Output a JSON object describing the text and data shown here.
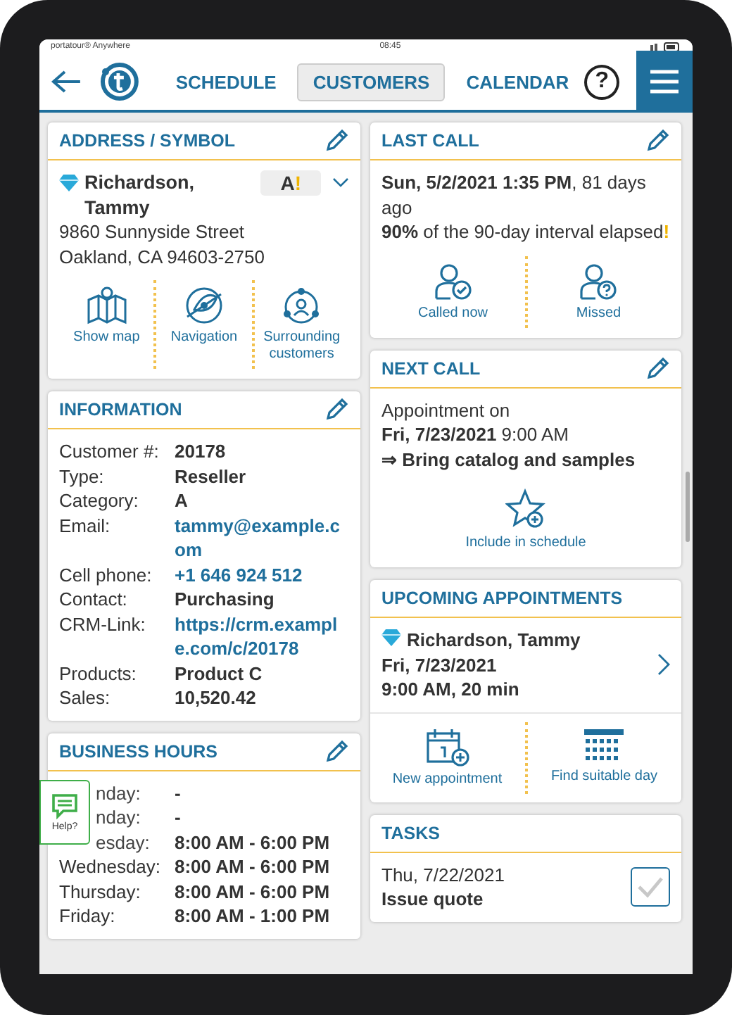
{
  "status_bar": {
    "carrier": "portatour® Anywhere",
    "time": "08:45"
  },
  "nav": {
    "tabs": [
      {
        "label": "SCHEDULE",
        "selected": false
      },
      {
        "label": "CUSTOMERS",
        "selected": true
      },
      {
        "label": "CALENDAR",
        "selected": false
      }
    ],
    "help": "?"
  },
  "address": {
    "title": "ADDRESS / SYMBOL",
    "name": "Richardson, Tammy",
    "street": "9860 Sunnyside Street",
    "city": "Oakland, CA 94603-2750",
    "symbol": "A",
    "symbol_mark": "!",
    "actions": [
      {
        "label": "Show map",
        "kind": "map"
      },
      {
        "label": "Navigation",
        "kind": "navigation"
      },
      {
        "label": "Surrounding customers",
        "kind": "surrounding"
      }
    ]
  },
  "information": {
    "title": "INFORMATION",
    "rows": [
      {
        "label": "Customer #:",
        "value": "20178",
        "kind": "text"
      },
      {
        "label": "Type:",
        "value": "Reseller",
        "kind": "text"
      },
      {
        "label": "Category:",
        "value": "A",
        "kind": "text"
      },
      {
        "label": "Email:",
        "value": "tammy@example.com",
        "kind": "link"
      },
      {
        "label": "Cell phone:",
        "value": "+1 646 924 512",
        "kind": "link"
      },
      {
        "label": "Contact:",
        "value": "Purchasing",
        "kind": "text"
      },
      {
        "label": "CRM-Link:",
        "value": "https://crm.example.com/c/20178",
        "kind": "link"
      },
      {
        "label": "Products:",
        "value": "Product C",
        "kind": "text"
      },
      {
        "label": "Sales:",
        "value": "10,520.42",
        "kind": "text"
      }
    ]
  },
  "business_hours": {
    "title": "BUSINESS HOURS",
    "rows": [
      {
        "day": "nday:",
        "hours": "-",
        "covered": true
      },
      {
        "day": "nday:",
        "hours": "-",
        "covered": true
      },
      {
        "day": "esday:",
        "hours": "8:00 AM - 6:00 PM",
        "covered": true
      },
      {
        "day": "Wednesday:",
        "hours": "8:00 AM - 6:00 PM",
        "covered": false
      },
      {
        "day": "Thursday:",
        "hours": "8:00 AM - 6:00 PM",
        "covered": false
      },
      {
        "day": "Friday:",
        "hours": "8:00 AM - 1:00 PM",
        "covered": false
      }
    ]
  },
  "help_widget": {
    "label": "Help?"
  },
  "last_call": {
    "title": "LAST CALL",
    "lines": [
      "**Sun, 5/2/2021 1:35 PM**, 81 days ago",
      "**90%** of the 90-day interval elapsed"
    ],
    "warning": "!",
    "actions": [
      {
        "label": "Called now",
        "kind": "called"
      },
      {
        "label": "Missed",
        "kind": "missed"
      }
    ]
  },
  "next_call": {
    "title": "NEXT CALL",
    "lines": [
      "Appointment on",
      "**Fri, 7/23/2021** 9:00 AM"
    ],
    "note": "⇒ Bring catalog and samples",
    "actions": [
      {
        "label": "Include in schedule",
        "kind": "star"
      }
    ]
  },
  "upcoming": {
    "title": "UPCOMING APPOINTMENTS",
    "name": "Richardson, Tammy",
    "date": "Fri, 7/23/2021",
    "time": "9:00 AM, 20 min",
    "actions": [
      {
        "label": "New appointment",
        "kind": "calendar-plus"
      },
      {
        "label": "Find suitable day",
        "kind": "calendar-grid"
      }
    ]
  },
  "tasks": {
    "title": "TASKS",
    "items": [
      {
        "date": "Thu, 7/22/2021",
        "title": "Issue quote",
        "done": false
      }
    ]
  }
}
